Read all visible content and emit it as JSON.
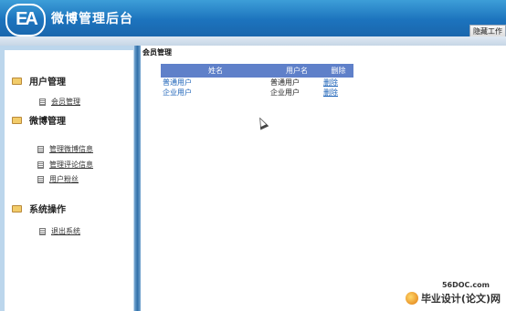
{
  "header": {
    "logo_text": "EA",
    "title": "微博管理后台",
    "hide_button_label": "隐藏工作"
  },
  "sidebar": {
    "sections": [
      {
        "label": "用户管理",
        "items": [
          "会员管理"
        ]
      },
      {
        "label": "微博管理",
        "items": [
          "管理微博信息",
          "管理评论信息",
          "用户粉丝"
        ]
      },
      {
        "label": "系统操作",
        "items": [
          "退出系统"
        ]
      }
    ]
  },
  "main": {
    "page_title": "会员管理",
    "table": {
      "headers": [
        "姓名",
        "用户名",
        "删除"
      ],
      "rows": [
        {
          "name": "普通用户",
          "username": "普通用户",
          "delete": "删除"
        },
        {
          "name": "企业用户",
          "username": "企业用户",
          "delete": "删除"
        }
      ]
    }
  },
  "watermark": {
    "domain": "56DOC.com",
    "text": "毕业设计(论文)网"
  },
  "colors": {
    "header_blue": "#1c73bd",
    "table_header": "#5f80c9",
    "link_blue": "#1d63b8",
    "sidebar_frame": "#bcd6ec"
  }
}
